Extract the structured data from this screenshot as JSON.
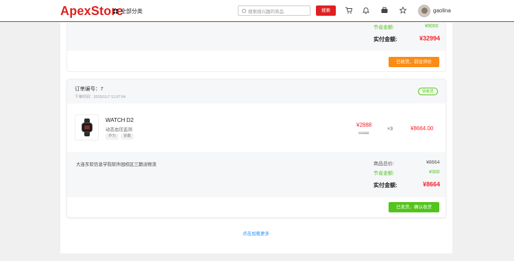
{
  "header": {
    "logo": "ApexStore",
    "category_label": "全部分类",
    "search_placeholder": "搜索感兴趣的商品",
    "search_button": "搜索",
    "icons": [
      "cart-icon",
      "bell-icon",
      "briefcase-icon",
      "star-icon"
    ],
    "username": "gaolina"
  },
  "prev_order": {
    "savings_label": "节省金额:",
    "savings_value": "¥9000",
    "paid_label": "实付金额:",
    "paid_value": "¥32994",
    "action_button": "已收货，前往评价"
  },
  "order": {
    "number_label": "订单编号：7",
    "time_label": "下单时间：2025/11/7 11:57:54",
    "status": "待收货",
    "product": {
      "name": "WATCH D2",
      "description": "动态血压监测",
      "tags": [
        "华为",
        "穿戴"
      ],
      "price": "¥2888",
      "original_price": "¥2988",
      "quantity": "×3",
      "subtotal": "¥8664.00"
    },
    "address": "大连东软信息学院软件园校区三期派物流",
    "total_label": "商品总价:",
    "total_value": "¥8664",
    "savings_label": "节省金额:",
    "savings_value": "¥300",
    "paid_label": "实付金额:",
    "paid_value": "¥8664",
    "action_button": "已发货，确认收货"
  },
  "load_more": "点击加载更多",
  "colors": {
    "brand": "#e02020",
    "green": "#52c41a",
    "orange": "#fa8c16",
    "link": "#1890ff"
  }
}
